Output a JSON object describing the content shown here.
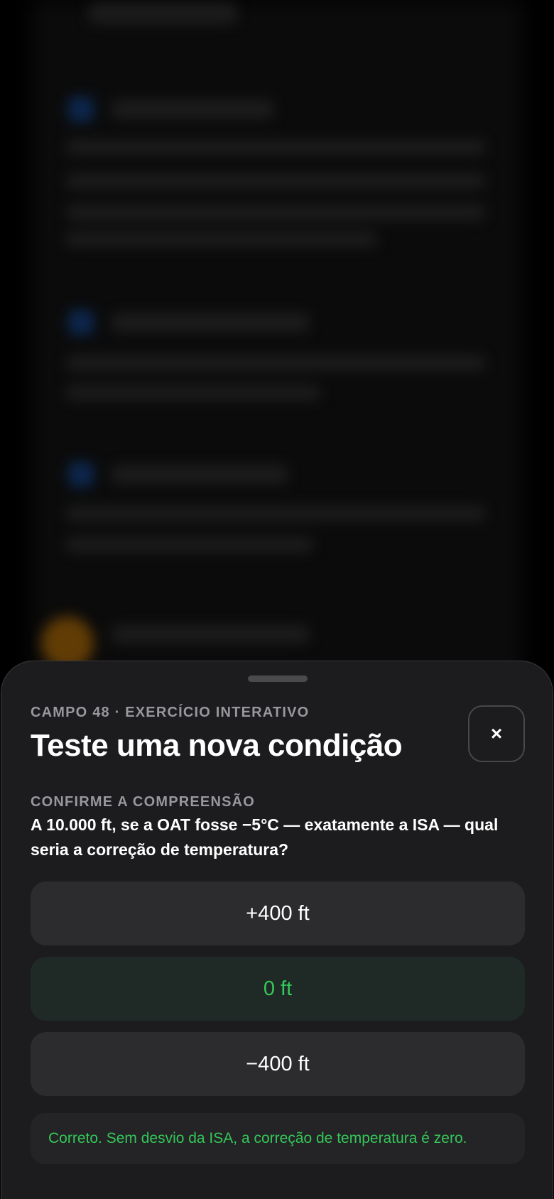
{
  "sheet": {
    "kicker": "CAMPO 48 · EXERCÍCIO INTERATIVO",
    "title": "Teste uma nova condição",
    "close_label": "×",
    "section_label": "CONFIRME A COMPREENSÃO",
    "question": "A 10.000 ft, se a OAT fosse −5°C — exatamente a ISA — qual seria a correção de temperatura?",
    "options": [
      {
        "label": "+400 ft",
        "state": "default"
      },
      {
        "label": "0 ft",
        "state": "correct"
      },
      {
        "label": "−400 ft",
        "state": "default"
      }
    ],
    "feedback": "Correto. Sem desvio da ISA, a correção de temperatura é zero."
  },
  "colors": {
    "sheet_bg": "#1c1c1e",
    "option_bg": "#2c2c2e",
    "correct_bg": "#1f2a26",
    "correct_text": "#34c759",
    "muted_text": "#98989d",
    "accent_blue_blur": "#0d2a55",
    "accent_amber_blur": "#6b4205"
  }
}
